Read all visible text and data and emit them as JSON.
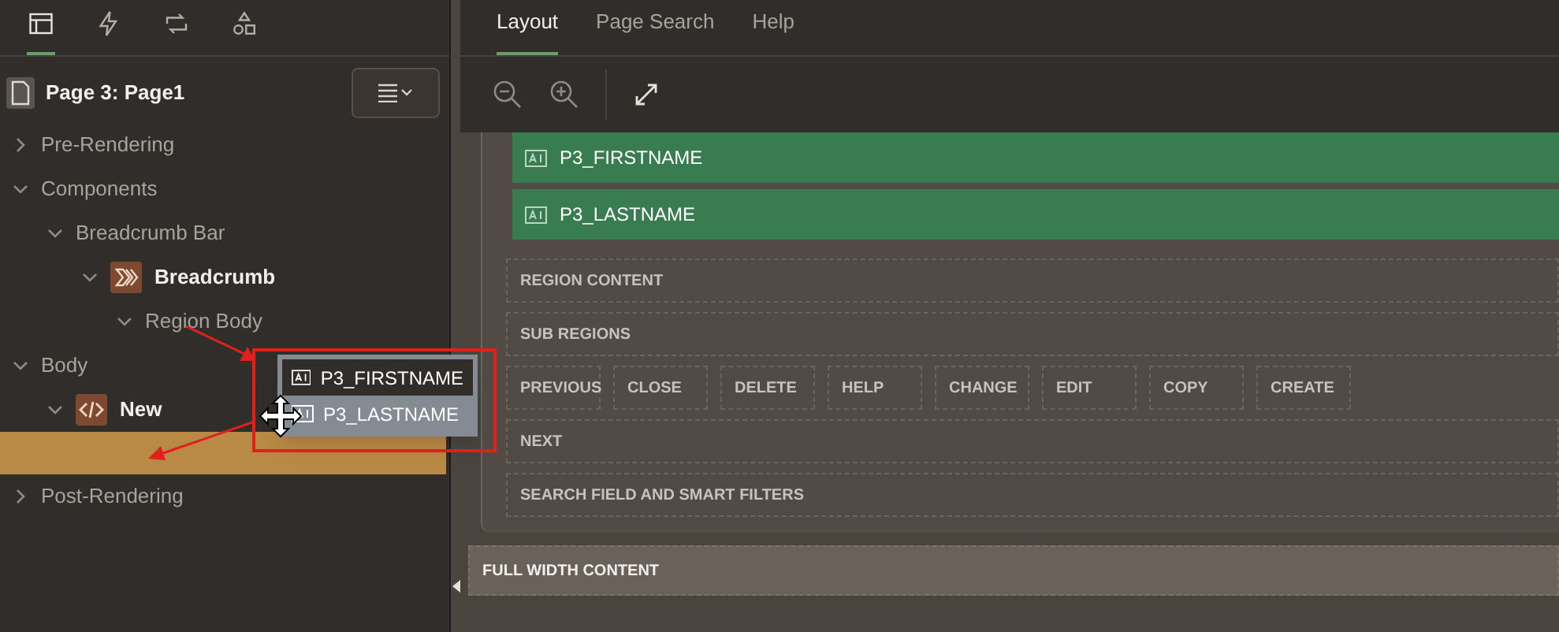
{
  "left_tabs": [
    {
      "kind": "rendering",
      "selected": true
    },
    {
      "kind": "actions",
      "selected": false
    },
    {
      "kind": "processing",
      "selected": false
    },
    {
      "kind": "shared",
      "selected": false
    }
  ],
  "page_title": "Page 3: Page1",
  "tree": [
    {
      "label": "Pre-Rendering",
      "expanded": false
    },
    {
      "label": "Components",
      "expanded": true,
      "children": [
        {
          "label": "Breadcrumb Bar",
          "expanded": true,
          "children": [
            {
              "label": "Breadcrumb",
              "kind": "breadcrumb",
              "expanded": true,
              "children": [
                {
                  "label": "Region Body",
                  "expanded": true
                }
              ]
            }
          ]
        }
      ]
    },
    {
      "label": "Body",
      "expanded": true,
      "children": [
        {
          "label": "New",
          "kind": "code",
          "expanded": true,
          "children": [
            {
              "kind": "drop-target"
            }
          ]
        }
      ]
    },
    {
      "label": "Post-Rendering",
      "expanded": false
    }
  ],
  "drag_items": [
    {
      "label": "P3_FIRSTNAME",
      "selected": true
    },
    {
      "label": "P3_LASTNAME",
      "selected": false
    }
  ],
  "right_tabs": [
    {
      "label": "Layout",
      "selected": true
    },
    {
      "label": "Page Search",
      "selected": false
    },
    {
      "label": "Help",
      "selected": false
    }
  ],
  "items": [
    "P3_FIRSTNAME",
    "P3_LASTNAME"
  ],
  "positions": [
    {
      "kind": "section",
      "label": "REGION CONTENT"
    },
    {
      "kind": "section",
      "label": "SUB REGIONS"
    },
    {
      "kind": "buttons",
      "labels": [
        "PREVIOUS",
        "CLOSE",
        "DELETE",
        "HELP",
        "CHANGE",
        "EDIT",
        "COPY",
        "CREATE"
      ]
    },
    {
      "kind": "section",
      "label": "NEXT"
    },
    {
      "kind": "section",
      "label": "SEARCH FIELD AND SMART FILTERS"
    }
  ],
  "full_width": "FULL WIDTH CONTENT"
}
